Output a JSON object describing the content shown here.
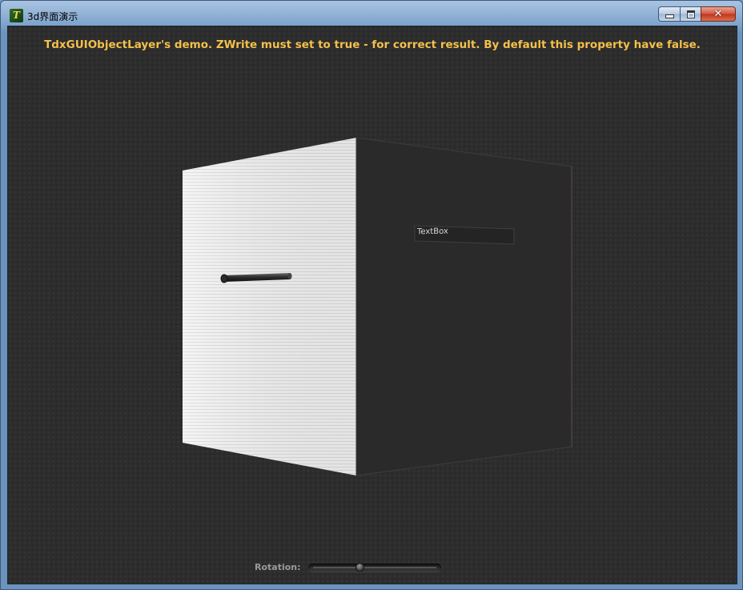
{
  "window": {
    "title": "3d界面演示",
    "app_icon_glyph": "T",
    "controls": {
      "minimize_icon": "minimize-icon",
      "maximize_icon": "maximize-icon",
      "close_icon": "close-icon",
      "close_glyph": "✕"
    }
  },
  "scene": {
    "headline": "TdxGUIObjectLayer's demo. ZWrite must set to true - for correct result. By default this property have false.",
    "textbox_text": "TextBox",
    "rotation_label": "Rotation:",
    "rotation_value": 0.38
  },
  "colors": {
    "headline": "#f5c04a",
    "background": "#2c2c2c",
    "cube_light_face": "#f2f2f2",
    "cube_dark_face": "#2a2a2a"
  }
}
